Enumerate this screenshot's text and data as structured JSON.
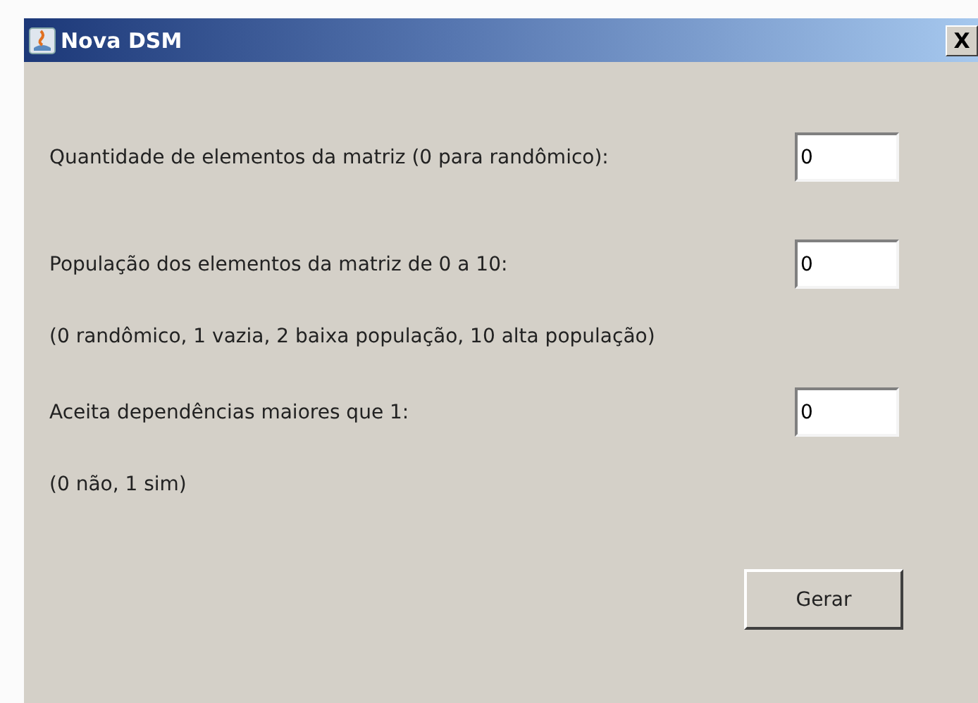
{
  "window": {
    "title": "Nova DSM",
    "close": "X"
  },
  "fields": [
    {
      "label": "Quantidade de elementos da matriz (0 para randômico):",
      "value": "0"
    },
    {
      "label": "População dos elementos da matriz de 0 a 10:",
      "value": "0",
      "hint": "(0 randômico, 1 vazia, 2 baixa população, 10 alta população)"
    },
    {
      "label": "Aceita dependências maiores que 1:",
      "value": "0",
      "hint": "(0 não, 1 sim)"
    }
  ],
  "button": "Gerar"
}
